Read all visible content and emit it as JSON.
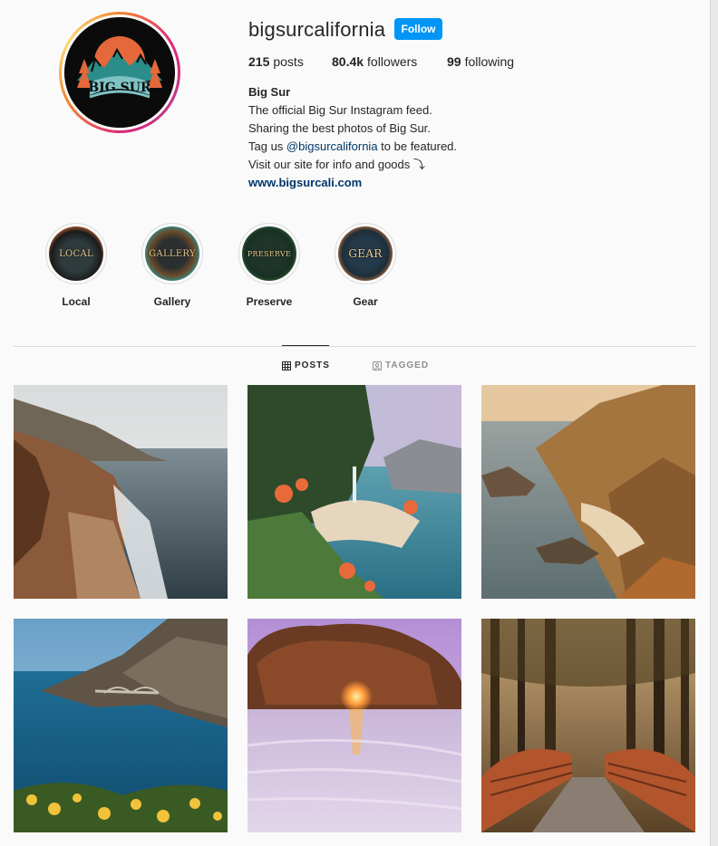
{
  "profile": {
    "username": "bigsurcalifornia",
    "follow_label": "Follow",
    "avatar_text": "BIG SUR",
    "stats": {
      "posts_count": "215",
      "posts_label": "posts",
      "followers_count": "80.4k",
      "followers_label": "followers",
      "following_count": "99",
      "following_label": "following"
    },
    "bio": {
      "name": "Big Sur",
      "line1": "The official Big Sur Instagram feed.",
      "line2": "Sharing the best photos of Big Sur.",
      "line3_prefix": "Tag us ",
      "line3_mention": "@bigsurcalifornia",
      "line3_suffix": " to be featured.",
      "line4": "Visit our site for info and goods ⤵",
      "website": "www.bigsurcali.com"
    }
  },
  "highlights": [
    {
      "cover_text": "LOCAL",
      "label": "Local"
    },
    {
      "cover_text": "GALLERY",
      "label": "Gallery"
    },
    {
      "cover_text": "PRESERVE",
      "label": "Preserve"
    },
    {
      "cover_text": "GEAR",
      "label": "Gear"
    }
  ],
  "tabs": {
    "posts": "POSTS",
    "tagged": "TAGGED"
  },
  "icons": {
    "grid": "grid-icon",
    "tagged": "tagged-person-icon"
  },
  "colors": {
    "accent": "#0095f6",
    "link": "#00376b"
  }
}
